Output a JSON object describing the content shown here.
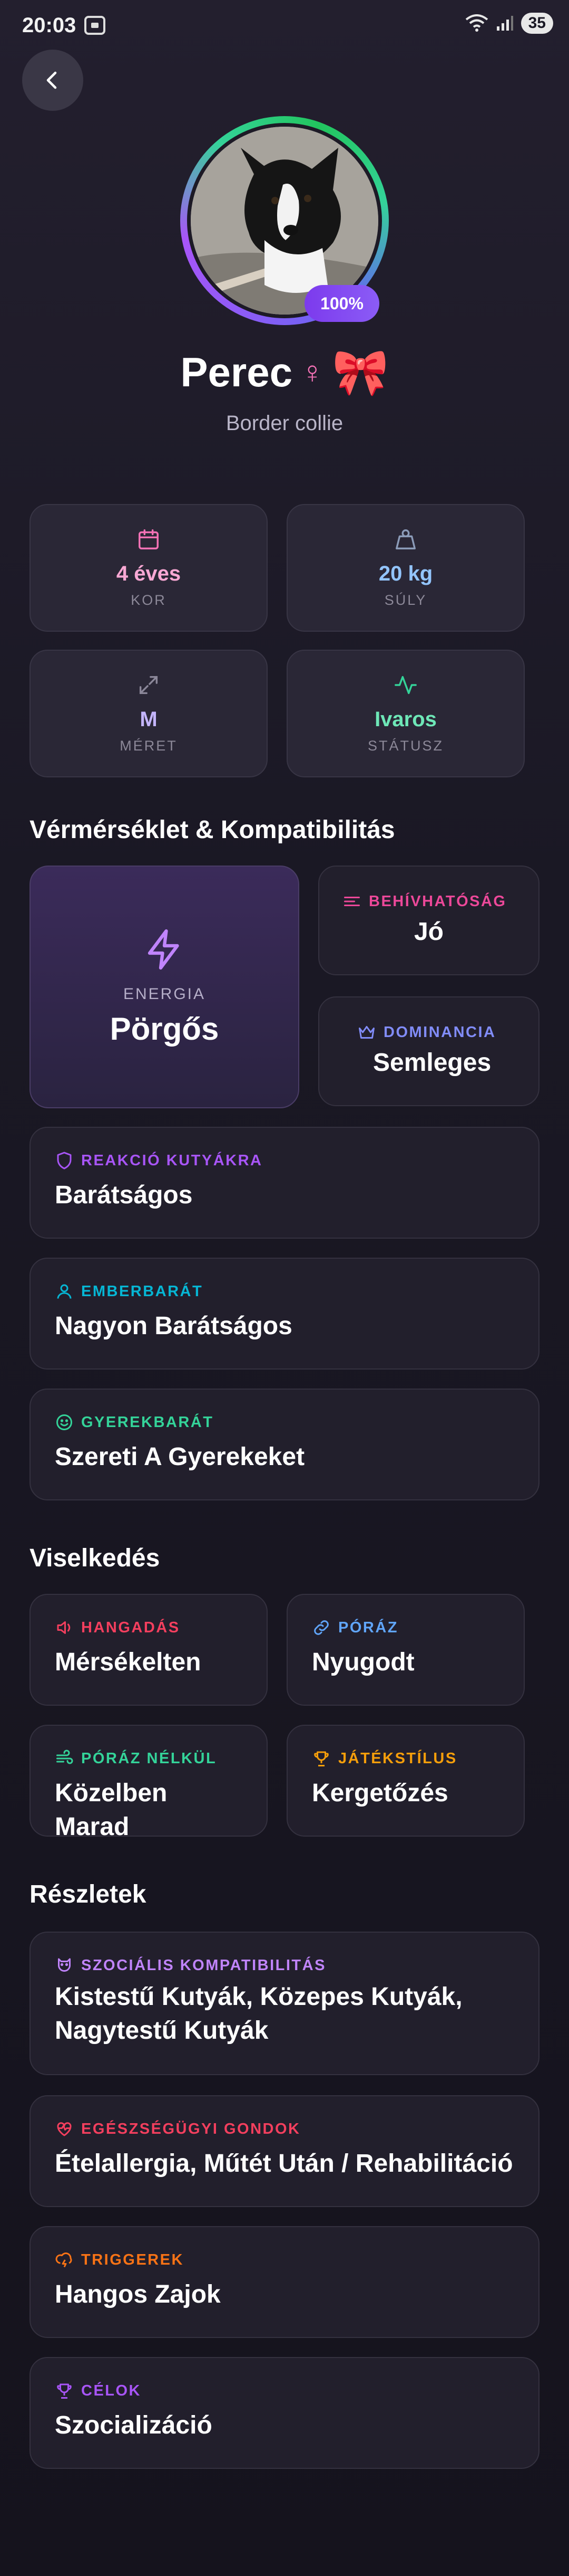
{
  "status_bar": {
    "time": "20:03",
    "battery": "35"
  },
  "profile": {
    "completion": "100%",
    "name": "Perec",
    "gender_symbol": "♀",
    "bow_emoji": "🎀",
    "breed": "Border collie"
  },
  "stats": [
    {
      "icon": "calendar-icon",
      "value": "4 éves",
      "label": "KOR",
      "color": "#f9a8d4"
    },
    {
      "icon": "weight-icon",
      "value": "20 kg",
      "label": "SÚLY",
      "color": "#93c5fd"
    },
    {
      "icon": "expand-icon",
      "value": "M",
      "label": "MÉRET",
      "color": "#c4b5fd"
    },
    {
      "icon": "activity-icon",
      "value": "Ivaros",
      "label": "STÁTUSZ",
      "color": "#6ee7b7"
    }
  ],
  "temperament": {
    "title": "Vérmérséklet & Kompatibilitás",
    "energy": {
      "label": "ENERGIA",
      "value": "Pörgős"
    },
    "recall": {
      "label": "BEHÍVHATÓSÁG",
      "value": "Jó",
      "color": "#ec4899"
    },
    "dominance": {
      "label": "DOMINANCIA",
      "value": "Semleges",
      "color": "#818cf8"
    },
    "dog_reaction": {
      "label": "REAKCIÓ KUTYÁKRA",
      "value": "Barátságos",
      "color": "#a855f7"
    },
    "people_friendly": {
      "label": "EMBERBARÁT",
      "value": "Nagyon Barátságos",
      "color": "#06b6d4"
    },
    "child_friendly": {
      "label": "GYEREKBARÁT",
      "value": "Szereti A Gyerekeket",
      "color": "#34d399"
    }
  },
  "behavior": {
    "title": "Viselkedés",
    "barking": {
      "label": "HANGADÁS",
      "value": "Mérsékelten",
      "color": "#f43f5e"
    },
    "leash": {
      "label": "PÓRÁZ",
      "value": "Nyugodt",
      "color": "#60a5fa"
    },
    "off_leash": {
      "label": "PÓRÁZ NÉLKÜL",
      "value": "Közelben Marad",
      "color": "#34d399"
    },
    "play_style": {
      "label": "JÁTÉKSTÍLUS",
      "value": "Kergetőzés",
      "color": "#f59e0b"
    }
  },
  "details": {
    "title": "Részletek",
    "social": {
      "label": "SZOCIÁLIS KOMPATIBILITÁS",
      "value": "Kistestű Kutyák, Közepes Kutyák, Nagytestű Kutyák",
      "color": "#c084fc"
    },
    "health": {
      "label": "EGÉSZSÉGÜGYI GONDOK",
      "value": "Ételallergia, Műtét Után / Rehabilitáció",
      "color": "#f43f5e"
    },
    "triggers": {
      "label": "TRIGGEREK",
      "value": "Hangos Zajok",
      "color": "#f97316"
    },
    "goals": {
      "label": "CÉLOK",
      "value": "Szocializáció",
      "color": "#a855f7"
    }
  }
}
